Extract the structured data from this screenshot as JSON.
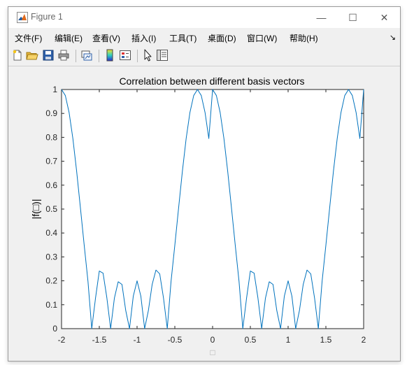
{
  "window": {
    "title": "Figure 1"
  },
  "window_controls": {
    "minimize": "—",
    "maximize": "☐",
    "close": "✕"
  },
  "menu": {
    "items": [
      "文件(F)",
      "编辑(E)",
      "查看(V)",
      "插入(I)",
      "工具(T)",
      "桌面(D)",
      "窗口(W)",
      "帮助(H)"
    ],
    "overflow_arrow": "↘"
  },
  "toolbar": {
    "buttons": [
      "new-figure-icon",
      "open-file-icon",
      "save-icon",
      "print-icon",
      "link-plot-icon",
      "insert-colorbar-icon",
      "insert-legend-icon",
      "edit-plot-icon",
      "property-inspector-icon"
    ]
  },
  "chart_data": {
    "type": "line",
    "title": "Correlation between different basis vectors",
    "xlabel": "□",
    "ylabel": "|f(□)|",
    "xlim": [
      -2,
      2
    ],
    "ylim": [
      0,
      1
    ],
    "xticks": [
      "-2",
      "-1.5",
      "-1",
      "-0.5",
      "0",
      "0.5",
      "1",
      "1.5",
      "2"
    ],
    "yticks": [
      "0",
      "0.1",
      "0.2",
      "0.3",
      "0.4",
      "0.5",
      "0.6",
      "0.7",
      "0.8",
      "0.9",
      "1"
    ],
    "grid": false,
    "line_color": "#0072BD",
    "series": [
      {
        "x": [
          -2.0,
          -1.95,
          -1.9,
          -1.85,
          -1.8,
          -1.75,
          -1.7,
          -1.65,
          -1.6,
          -1.55,
          -1.5,
          -1.45,
          -1.4,
          -1.35,
          -1.3,
          -1.25,
          -1.2,
          -1.15,
          -1.1,
          -1.05,
          -1.0,
          -0.95,
          -0.9,
          -0.85,
          -0.8,
          -0.75,
          -0.7,
          -0.65,
          -0.6,
          -0.55,
          -0.5,
          -0.45,
          -0.4,
          -0.35,
          -0.3,
          -0.25,
          -0.2,
          -0.15,
          -0.1,
          -0.05,
          0.0,
          0.05,
          0.1,
          0.15,
          0.2,
          0.25,
          0.3,
          0.35,
          0.4,
          0.45,
          0.5,
          0.55,
          0.6,
          0.65,
          0.7,
          0.75,
          0.8,
          0.85,
          0.9,
          0.95,
          1.0,
          1.05,
          1.1,
          1.15,
          1.2,
          1.25,
          1.3,
          1.35,
          1.4,
          1.45,
          1.5,
          1.55,
          1.6,
          1.65,
          1.7,
          1.75,
          1.8,
          1.85,
          1.9,
          1.95,
          2.0
        ],
        "y": [
          1.0,
          0.975,
          0.904,
          0.795,
          0.658,
          0.505,
          0.349,
          0.198,
          0.0,
          0.128,
          0.241,
          0.232,
          0.129,
          0.0,
          0.128,
          0.196,
          0.185,
          0.076,
          0.0,
          0.136,
          0.2,
          0.136,
          0.0,
          0.076,
          0.185,
          0.245,
          0.229,
          0.128,
          0.0,
          0.198,
          0.349,
          0.505,
          0.658,
          0.795,
          0.904,
          0.975,
          1.0,
          0.975,
          0.904,
          0.795,
          1.0,
          0.975,
          0.904,
          0.795,
          0.658,
          0.505,
          0.349,
          0.198,
          0.0,
          0.128,
          0.241,
          0.232,
          0.129,
          0.0,
          0.128,
          0.196,
          0.185,
          0.076,
          0.0,
          0.136,
          0.2,
          0.136,
          0.0,
          0.076,
          0.185,
          0.245,
          0.229,
          0.128,
          0.0,
          0.198,
          0.349,
          0.505,
          0.658,
          0.795,
          0.904,
          0.975,
          1.0,
          0.975,
          0.904,
          0.795,
          1.0
        ]
      }
    ]
  }
}
